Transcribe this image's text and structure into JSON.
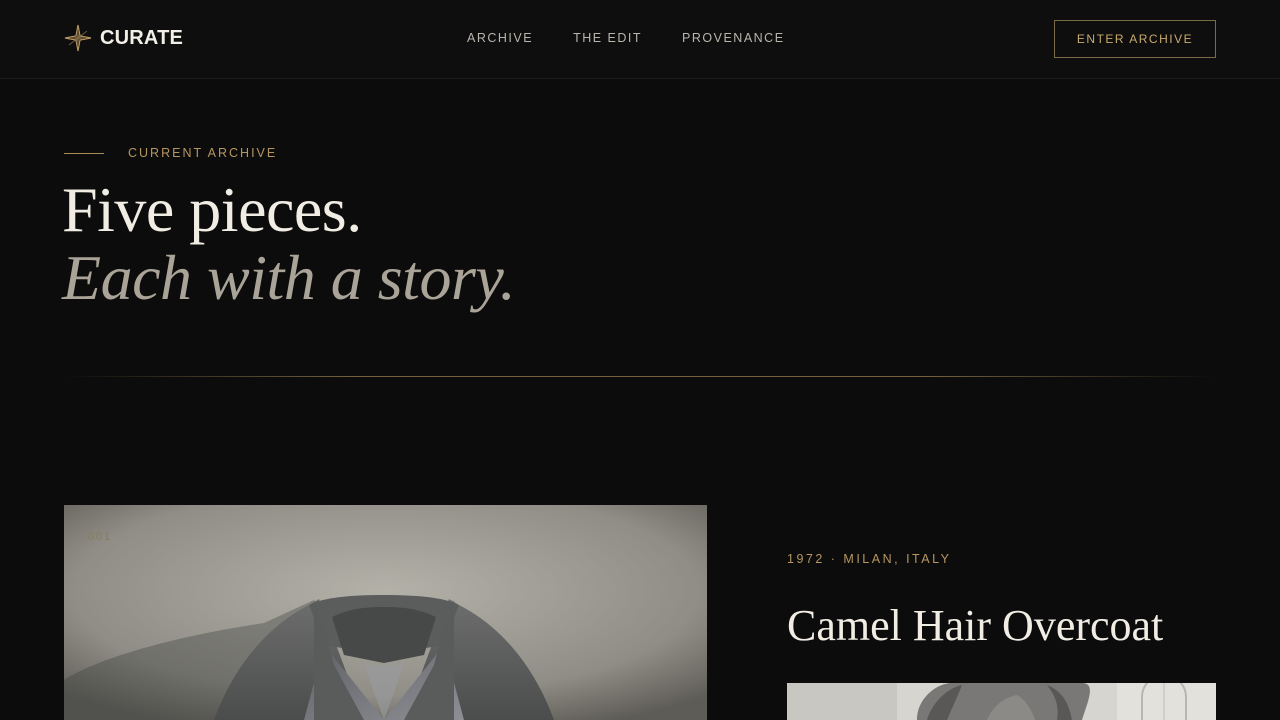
{
  "nav": {
    "brand": "CURATE",
    "logo_icon": "compass-star-icon",
    "items": [
      {
        "label": "ARCHIVE"
      },
      {
        "label": "THE EDIT"
      },
      {
        "label": "PROVENANCE"
      }
    ],
    "cta_label": "ENTER ARCHIVE"
  },
  "hero": {
    "eyebrow": "CURRENT ARCHIVE",
    "headline": "Five pieces.",
    "subheadline": "Each with a story."
  },
  "featured": {
    "number": "001",
    "meta": "1972 · MILAN, ITALY",
    "title": "Camel Hair Overcoat"
  },
  "colors": {
    "background": "#0c0c0c",
    "accent_gold": "#b69660",
    "headline": "#f1ede4",
    "subheadline": "#aaa498"
  }
}
